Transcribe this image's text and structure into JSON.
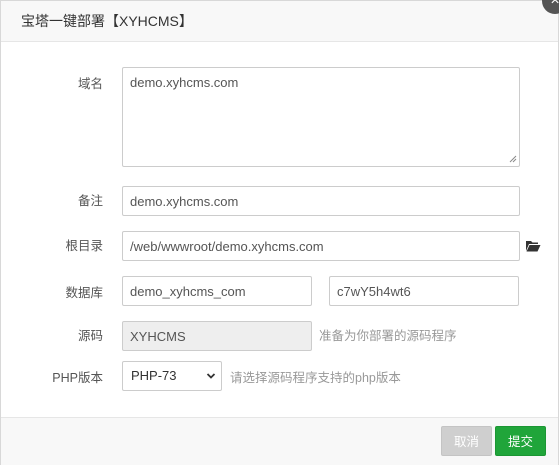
{
  "dialog": {
    "title": "宝塔一键部署【XYHCMS】",
    "close_label": "×"
  },
  "form": {
    "domain": {
      "label": "域名",
      "value": "demo.xyhcms.com"
    },
    "remark": {
      "label": "备注",
      "value": "demo.xyhcms.com"
    },
    "root_dir": {
      "label": "根目录",
      "value": "/web/wwwroot/demo.xyhcms.com"
    },
    "database": {
      "label": "数据库",
      "name_value": "demo_xyhcms_com",
      "password_value": "c7wY5h4wt6"
    },
    "source": {
      "label": "源码",
      "value": "XYHCMS",
      "hint": "准备为你部署的源码程序"
    },
    "php": {
      "label": "PHP版本",
      "selected": "PHP-73",
      "hint": "请选择源码程序支持的php版本"
    }
  },
  "footer": {
    "cancel_label": "取消",
    "submit_label": "提交"
  },
  "icons": {
    "folder": "folder-open-icon",
    "close": "close-icon",
    "chevron": "chevron-down-icon"
  },
  "colors": {
    "submit_bg": "#20a53a",
    "cancel_bg": "#cfcfcf",
    "folder": "#333333"
  }
}
